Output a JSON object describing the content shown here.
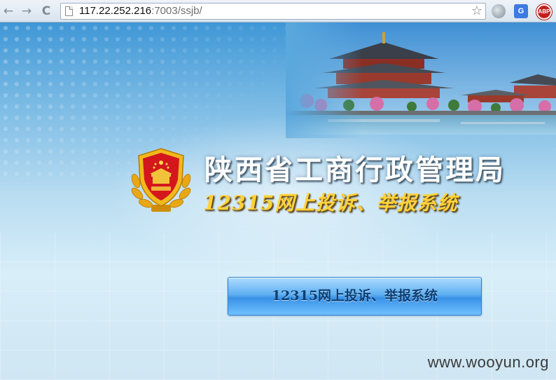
{
  "browser": {
    "url_host": "117.22.252.216",
    "url_rest": ":7003/ssjb/",
    "back_glyph": "←",
    "forward_glyph": "→",
    "reload_glyph": "C",
    "star_glyph": "☆",
    "translate_label": "G",
    "abp_label": "ABP",
    "icons": [
      "back-arrow-icon",
      "forward-arrow-icon",
      "reload-icon",
      "page-icon",
      "bookmark-star-icon",
      "globe-icon",
      "translate-icon",
      "adblock-icon"
    ]
  },
  "page": {
    "title": "陕西省工商行政管理局",
    "subtitle": "12315网上投诉、举报系统",
    "enter_button": "12315网上投诉、举报系统",
    "watermark": "www.wooyun.org"
  },
  "colors": {
    "title": "#ffffff",
    "subtitle": "#ffd23c",
    "button_text": "#0c3f74",
    "emblem_red": "#d3171d",
    "emblem_gold": "#f2b91b"
  }
}
